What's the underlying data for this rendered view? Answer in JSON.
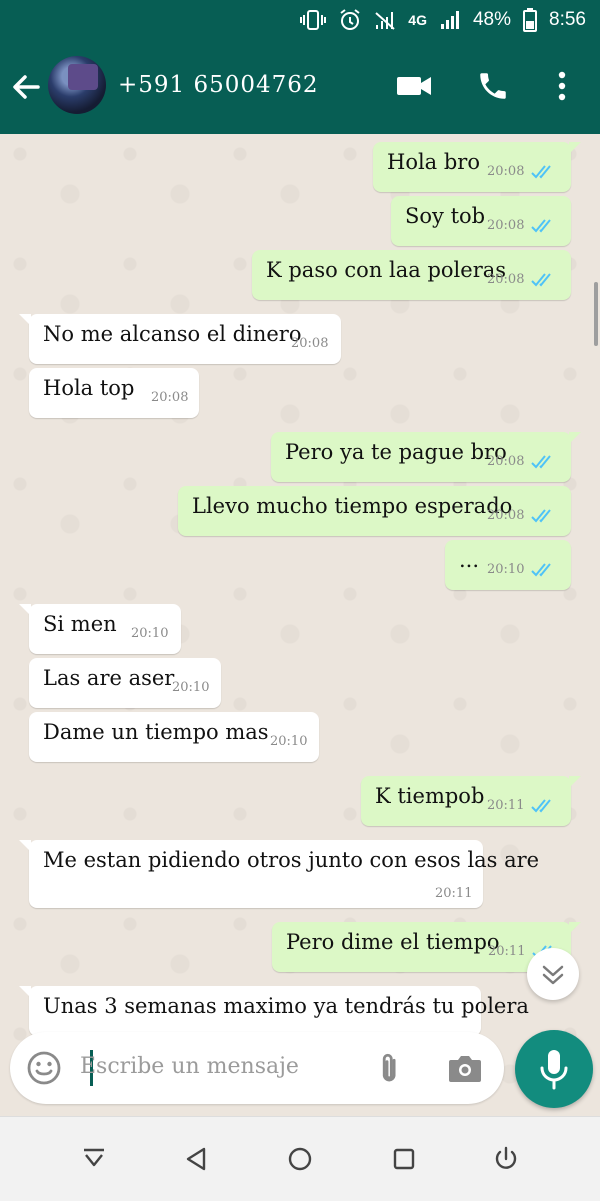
{
  "status_bar": {
    "battery": "48%",
    "time": "8:56",
    "network": "4G"
  },
  "header": {
    "contact": "+591 65004762",
    "icons": [
      "back-arrow-icon",
      "video-call-icon",
      "phone-icon",
      "more-vert-icon"
    ]
  },
  "messages": [
    {
      "dir": "out",
      "text": "Hola bro",
      "time": "20:08",
      "ticks": "read"
    },
    {
      "dir": "out",
      "text": "Soy tob",
      "time": "20:08",
      "ticks": "read"
    },
    {
      "dir": "out",
      "text": "K paso con laa poleras",
      "time": "20:08",
      "ticks": "read"
    },
    {
      "dir": "in",
      "text": "No me alcanso el dinero",
      "time": "20:08"
    },
    {
      "dir": "in",
      "text": "Hola top",
      "time": "20:08"
    },
    {
      "dir": "out",
      "text": "Pero ya te pague bro",
      "time": "20:08",
      "ticks": "read"
    },
    {
      "dir": "out",
      "text": "Llevo mucho tiempo esperado",
      "time": "20:08",
      "ticks": "read"
    },
    {
      "dir": "out",
      "text": "...",
      "time": "20:10",
      "ticks": "read"
    },
    {
      "dir": "in",
      "text": "Si men",
      "time": "20:10"
    },
    {
      "dir": "in",
      "text": "Las are aser",
      "time": "20:10"
    },
    {
      "dir": "in",
      "text": "Dame un tiempo mas",
      "time": "20:10"
    },
    {
      "dir": "out",
      "text": "K tiempob",
      "time": "20:11",
      "ticks": "read"
    },
    {
      "dir": "in",
      "text": "Me estan pidiendo otros junto con esos las are",
      "time": "20:11"
    },
    {
      "dir": "out",
      "text": "Pero dime el tiempo",
      "time": "20:11",
      "ticks": "read"
    },
    {
      "dir": "in",
      "text": "Unas 3 semanas maximo ya tendrás tu polera",
      "time": ""
    }
  ],
  "composer": {
    "placeholder": "Escribe un mensaje",
    "icons": [
      "emoji-icon",
      "attach-icon",
      "camera-icon",
      "mic-icon"
    ]
  },
  "colors": {
    "header": "#075e54",
    "outgoing_bubble": "#dcf8c6",
    "incoming_bubble": "#ffffff",
    "read_ticks": "#4fc3f7",
    "mic_button": "#128c7e"
  }
}
